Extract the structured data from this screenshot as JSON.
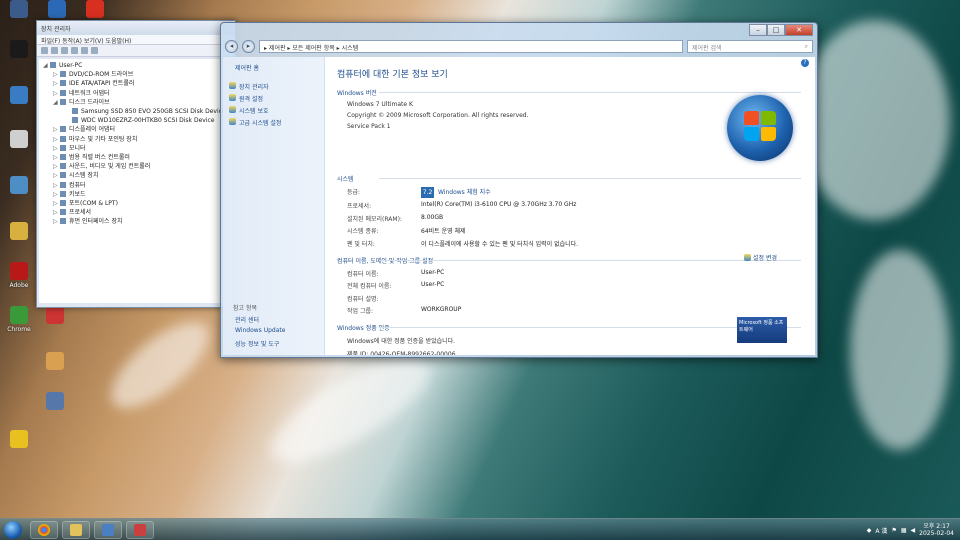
{
  "desktop": {
    "icons": [
      {
        "label": "",
        "color": "#3b5b8a"
      },
      {
        "label": "",
        "color": "#2b69b6"
      },
      {
        "label": "",
        "color": "#d83020"
      },
      {
        "label": "",
        "color": "#1a1a1a"
      },
      {
        "label": "",
        "color": "#3a7cc4"
      },
      {
        "label": "",
        "color": "#cfcfcf"
      },
      {
        "label": "",
        "color": "#4d8ec4"
      },
      {
        "label": "",
        "color": "#d8b040"
      },
      {
        "label": "Adobe",
        "color": "#b81818"
      },
      {
        "label": "Chrome",
        "color": "#3a9a3a"
      },
      {
        "label": "",
        "color": "#cc3333"
      },
      {
        "label": "",
        "color": "#d8a050"
      },
      {
        "label": "",
        "color": "#e8c020"
      },
      {
        "label": "",
        "color": "#5577aa"
      }
    ]
  },
  "device_manager": {
    "title": "장치 관리자",
    "menu": "파일(F)  동작(A)  보기(V)  도움말(H)",
    "tree": [
      {
        "level": 0,
        "label": "User-PC"
      },
      {
        "level": 1,
        "label": "DVD/CD-ROM 드라이브"
      },
      {
        "level": 1,
        "label": "IDE ATA/ATAPI 컨트롤러"
      },
      {
        "level": 1,
        "label": "네트워크 어댑터"
      },
      {
        "level": 1,
        "label": "디스크 드라이브"
      },
      {
        "level": 2,
        "label": "Samsung SSD 850 EVO 250GB SCSI Disk Device"
      },
      {
        "level": 2,
        "label": "WDC WD10EZRZ-00HTKB0 SCSI Disk Device"
      },
      {
        "level": 1,
        "label": "디스플레이 어댑터"
      },
      {
        "level": 1,
        "label": "마우스 및 기타 포인팅 장치"
      },
      {
        "level": 1,
        "label": "모니터"
      },
      {
        "level": 1,
        "label": "범용 직렬 버스 컨트롤러"
      },
      {
        "level": 1,
        "label": "사운드, 비디오 및 게임 컨트롤러"
      },
      {
        "level": 1,
        "label": "시스템 장치"
      },
      {
        "level": 1,
        "label": "컴퓨터"
      },
      {
        "level": 1,
        "label": "키보드"
      },
      {
        "level": 1,
        "label": "포트(COM & LPT)"
      },
      {
        "level": 1,
        "label": "프로세서"
      },
      {
        "level": 1,
        "label": "휴먼 인터페이스 장치"
      }
    ]
  },
  "system_window": {
    "address": "▸ 제어판 ▸ 모든 제어판 항목 ▸ 시스템",
    "search_placeholder": "제어판 검색",
    "left_pane": {
      "home": "제어판 홈",
      "links": [
        "장치 관리자",
        "원격 설정",
        "시스템 보호",
        "고급 시스템 설정"
      ],
      "see_also_title": "참고 항목",
      "see_also": [
        "관리 센터",
        "Windows Update",
        "성능 정보 및 도구"
      ]
    },
    "page_title": "컴퓨터에 대한 기본 정보 보기",
    "edition_section": "Windows 버전",
    "edition": "Windows 7 Ultimate K",
    "copyright": "Copyright © 2009 Microsoft Corporation. All rights reserved.",
    "service_pack": "Service Pack 1",
    "system_section": "시스템",
    "rating_label": "등급:",
    "rating_badge": "7.2",
    "rating_link": "Windows 체험 지수",
    "processor_label": "프로세서:",
    "processor": "Intel(R) Core(TM) i3-6100 CPU @ 3.70GHz  3.70 GHz",
    "ram_label": "설치된 메모리(RAM):",
    "ram": "8.00GB",
    "systype_label": "시스템 종류:",
    "systype": "64비트 운영 체제",
    "pen_label": "펜 및 터치:",
    "pen": "이 디스플레이에 사용할 수 있는 펜 및 터치식 입력이 없습니다.",
    "computer_section": "컴퓨터 이름, 도메인 및 작업 그룹 설정",
    "name_label": "컴퓨터 이름:",
    "name": "User-PC",
    "fullname_label": "전체 컴퓨터 이름:",
    "fullname": "User-PC",
    "desc_label": "컴퓨터 설명:",
    "desc": "",
    "workgroup_label": "작업 그룹:",
    "workgroup": "WORKGROUP",
    "settings_link": "설정 변경",
    "activation_section": "Windows 정품 인증",
    "activation": "Windows에 대한 정품 인증을 받았습니다.",
    "product_id": "제품 ID: 00426-OEM-8992662-00006",
    "genuine_text": "Microsoft 정품 소프트웨어"
  },
  "taskbar": {
    "clock_time": "오후 2:17",
    "clock_date": "2025-02-04",
    "ime": "A 漢"
  },
  "colors": {
    "link": "#1e4d8c",
    "window_border": "#5f7796"
  }
}
